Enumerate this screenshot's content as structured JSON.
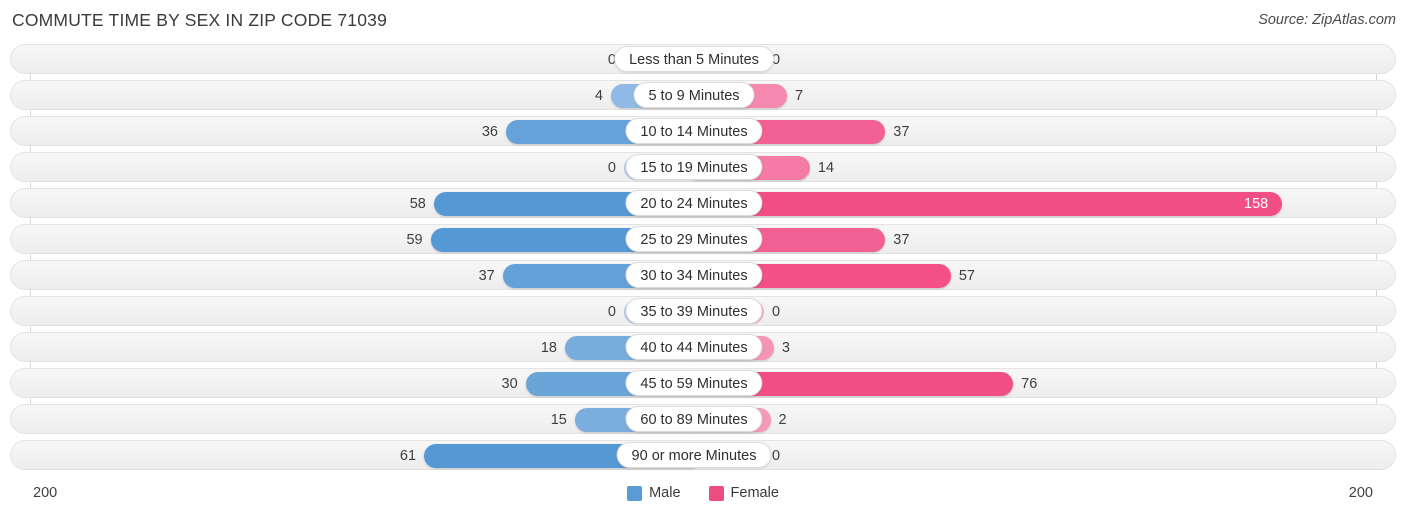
{
  "header": {
    "title": "COMMUTE TIME BY SEX IN ZIP CODE 71039",
    "source": "Source: ZipAtlas.com"
  },
  "legend": {
    "items": [
      {
        "label": "Male",
        "color": "#5B9BD5"
      },
      {
        "label": "Female",
        "color": "#EE4C84"
      }
    ]
  },
  "axis": {
    "left_label": "200",
    "right_label": "200"
  },
  "chart_data": {
    "type": "bar",
    "orientation": "horizontal-diverging",
    "title": "COMMUTE TIME BY SEX IN ZIP CODE 71039",
    "xlabel": "",
    "ylabel": "",
    "xlim": [
      200,
      200
    ],
    "axis_max": 200,
    "grid": true,
    "legend_position": "bottom-center",
    "categories": [
      "Less than 5 Minutes",
      "5 to 9 Minutes",
      "10 to 14 Minutes",
      "15 to 19 Minutes",
      "20 to 24 Minutes",
      "25 to 29 Minutes",
      "30 to 34 Minutes",
      "35 to 39 Minutes",
      "40 to 44 Minutes",
      "45 to 59 Minutes",
      "60 to 89 Minutes",
      "90 or more Minutes"
    ],
    "series": [
      {
        "name": "Male",
        "color": "#5B9BD5",
        "values": [
          0,
          4,
          36,
          0,
          58,
          59,
          37,
          0,
          18,
          30,
          15,
          61
        ]
      },
      {
        "name": "Female",
        "color": "#EE4C84",
        "values": [
          0,
          7,
          37,
          14,
          158,
          37,
          57,
          0,
          3,
          76,
          2,
          0
        ]
      }
    ]
  },
  "rows": [
    {
      "label": "Less than 5 Minutes",
      "male": "0",
      "female": "0"
    },
    {
      "label": "5 to 9 Minutes",
      "male": "4",
      "female": "7"
    },
    {
      "label": "10 to 14 Minutes",
      "male": "36",
      "female": "37"
    },
    {
      "label": "15 to 19 Minutes",
      "male": "0",
      "female": "14"
    },
    {
      "label": "20 to 24 Minutes",
      "male": "58",
      "female": "158"
    },
    {
      "label": "25 to 29 Minutes",
      "male": "59",
      "female": "37"
    },
    {
      "label": "30 to 34 Minutes",
      "male": "37",
      "female": "57"
    },
    {
      "label": "35 to 39 Minutes",
      "male": "0",
      "female": "0"
    },
    {
      "label": "40 to 44 Minutes",
      "male": "18",
      "female": "3"
    },
    {
      "label": "45 to 59 Minutes",
      "male": "30",
      "female": "76"
    },
    {
      "label": "60 to 89 Minutes",
      "male": "15",
      "female": "2"
    },
    {
      "label": "90 or more Minutes",
      "male": "61",
      "female": "0"
    }
  ]
}
